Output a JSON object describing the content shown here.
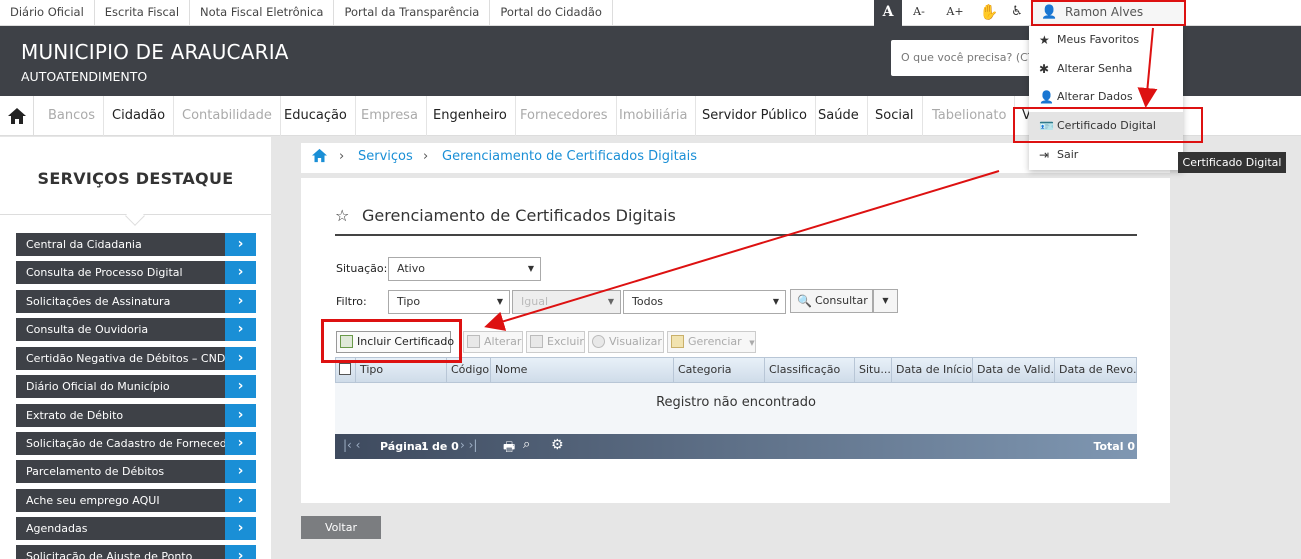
{
  "top_links": [
    "Diário Oficial",
    "Escrita Fiscal",
    "Nota Fiscal Eletrônica",
    "Portal da Transparência",
    "Portal do Cidadão"
  ],
  "font_tools": {
    "normal": "A",
    "decrease": "A-",
    "increase": "A+"
  },
  "user": {
    "name": "Ramon Alves Gomes"
  },
  "header": {
    "title": "MUNICIPIO DE ARAUCARIA",
    "subtitle": "AUTOATENDIMENTO",
    "search_placeholder": "O que você precisa? (CTR"
  },
  "nav": [
    "Bancos",
    "Cidadão",
    "Contabilidade",
    "Educação",
    "Empresa",
    "Engenheiro",
    "Fornecedores",
    "Imobiliária",
    "Servidor Público",
    "Saúde",
    "Social",
    "Tabelionato",
    "V"
  ],
  "sidebar": {
    "title": "SERVIÇOS DESTAQUE",
    "items": [
      "Central da Cidadania",
      "Consulta de Processo Digital",
      "Solicitações de Assinatura",
      "Consulta de Ouvidoria",
      "Certidão Negativa de Débitos – CND",
      "Diário Oficial do Município",
      "Extrato de Débito",
      "Solicitação de Cadastro de Fornecedor",
      "Parcelamento de Débitos",
      "Ache seu emprego AQUI",
      "Agendadas",
      "Solicitação de Ajuste de Ponto"
    ]
  },
  "breadcrumb": {
    "level1": "Serviços",
    "level2": "Gerenciamento de Certificados Digitais"
  },
  "page": {
    "title": "Gerenciamento de Certificados Digitais",
    "situacao_label": "Situação:",
    "situacao_value": "Ativo",
    "filtro_label": "Filtro:",
    "filtro_field": "Tipo",
    "filtro_op": "Igual",
    "filtro_value": "Todos",
    "consultar": "Consultar"
  },
  "toolbar": {
    "incluir": "Incluir Certificado",
    "alterar": "Alterar",
    "excluir": "Excluir",
    "visualizar": "Visualizar",
    "gerenciar": "Gerenciar"
  },
  "grid": {
    "columns": [
      "Tipo",
      "Código",
      "Nome",
      "Categoria",
      "Classificação",
      "Situ...",
      "Data de Início",
      "Data de Valid...",
      "Data de Revo..."
    ],
    "empty": "Registro não encontrado",
    "pager_label": "Página:",
    "page": "1",
    "of": "de 0",
    "total": "Total 0"
  },
  "voltar": "Voltar",
  "dropdown": [
    "Meus Favoritos",
    "Alterar Senha",
    "Alterar Dados",
    "Certificado Digital",
    "Sair"
  ],
  "tooltip": "Certificado Digital",
  "colors": {
    "header": "#3e4147",
    "accent_blue": "#1a8fd6",
    "link": "#1a8fd6",
    "highlight": "#dd1111"
  }
}
